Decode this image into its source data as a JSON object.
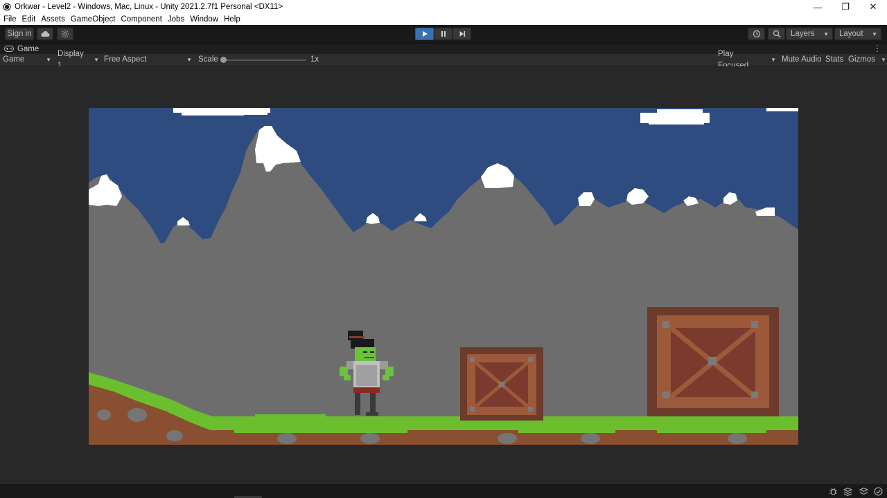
{
  "window": {
    "title": "Orkwar - Level2 - Windows, Mac, Linux - Unity 2021.2.7f1 Personal <DX11>",
    "controls": {
      "minimize": "—",
      "restore": "❐",
      "close": "✕"
    }
  },
  "menu": [
    "File",
    "Edit",
    "Assets",
    "GameObject",
    "Component",
    "Jobs",
    "Window",
    "Help"
  ],
  "toolbar": {
    "sign_in": "Sign in",
    "layers": "Layers",
    "layout": "Layout",
    "play_active": true,
    "icons": [
      "cloud-icon",
      "collab-icon",
      "play-icon",
      "pause-icon",
      "step-icon",
      "history-icon",
      "search-icon"
    ]
  },
  "tab": {
    "label": "Game",
    "menu_glyph": "⋮"
  },
  "game_toolbar": {
    "view": "Game",
    "display": "Display 1",
    "aspect": "Free Aspect",
    "scale_label": "Scale",
    "scale_value": "1x",
    "play_focused": "Play Focused",
    "mute_audio": "Mute Audio",
    "stats": "Stats",
    "gizmos": "Gizmos"
  },
  "colors": {
    "sky": "#2f4c80",
    "mountain": "#6d6d6d",
    "snow": "#ffffff",
    "grass": "#6bbf2e",
    "dirt": "#8a4e30",
    "rock": "#757575",
    "crate_frame": "#6c3b2c",
    "crate_face": "#9c5a3a",
    "crate_inner": "#7a3a2e",
    "orc_skin": "#6cc23a",
    "accent_blue": "#3a72b0"
  }
}
